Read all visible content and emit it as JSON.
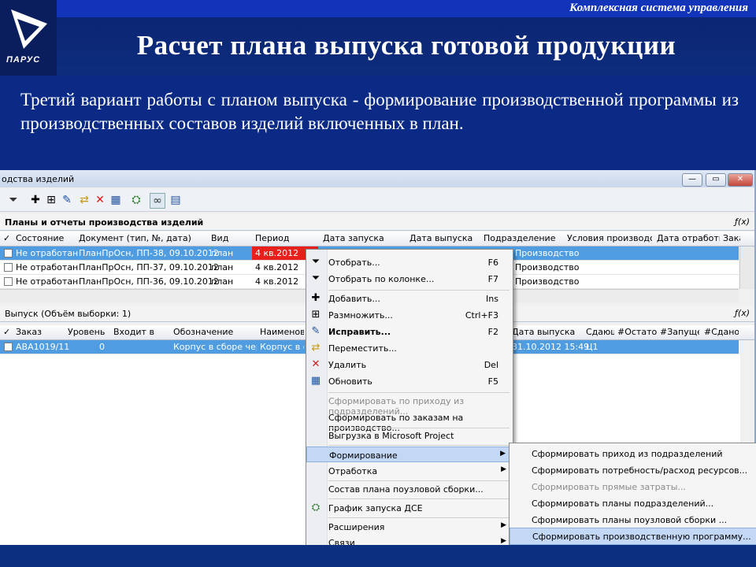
{
  "slide": {
    "header_strip": "Комплексная система управления",
    "logo_text": "ПАРУС",
    "title": "Расчет плана выпуска готовой продукции",
    "lead": "Третий  вариант работы с планом выпуска  - формирование производственной программы из производственных составов изделий включенных в план."
  },
  "window": {
    "title": "одства изделий",
    "controls": {
      "minimize": "—",
      "maximize": "▭",
      "close": "✕"
    }
  },
  "toolbar": {
    "icons": [
      "filter-icon",
      "add-icon",
      "multiply-icon",
      "edit-icon",
      "move-icon",
      "delete-icon",
      "refresh-icon",
      "network-icon",
      "binoculars-icon",
      "report-icon"
    ]
  },
  "plans": {
    "section_title": "Планы и отчеты производства изделий",
    "fx": "ƒ(x)",
    "columns": [
      "Состояние",
      "Документ (тип, №, дата)",
      "Вид",
      "Период",
      "Дата запуска",
      "Дата выпуска",
      "Подразделение",
      "Условия производства",
      "Дата отработки",
      "Зака"
    ],
    "rows": [
      {
        "state": "Не отработан",
        "doc": "ПланПрОсн, ПП-38, 09.10.2012",
        "kind": "план",
        "period": "4 кв.2012",
        "dept": "Производство"
      },
      {
        "state": "Не отработан",
        "doc": "ПланПрОсн, ПП-37, 09.10.2012",
        "kind": "план",
        "period": "4 кв.2012",
        "dept": "Производство"
      },
      {
        "state": "Не отработан",
        "doc": "ПланПрОсн, ПП-36, 09.10.2012",
        "kind": "план",
        "period": "4 кв.2012",
        "dept": "Производство"
      }
    ]
  },
  "output": {
    "section_title": "Выпуск (Объём выборки: 1)",
    "fx": "ƒ(x)",
    "columns": [
      "Заказ",
      "Уровень",
      "Входит в",
      "Обозначение",
      "Наименова",
      "Дата выпуска",
      "Сдающ",
      "#Остаток",
      "#Запущено",
      "#Сдано"
    ],
    "rows": [
      {
        "order": "ABA1019/11",
        "level": "0",
        "enters": "",
        "designation": "Корпус в сборе чертеж",
        "name": "Корпус в сбо",
        "date": "31.10.2012 15:49",
        "issuer": "Ц1"
      }
    ]
  },
  "context_menu": {
    "items": [
      {
        "label": "Отобрать...",
        "shortcut": "F6",
        "icon": "filter-icon"
      },
      {
        "label": "Отобрать по колонке...",
        "shortcut": "F7",
        "icon": "column-filter-icon"
      },
      {
        "label": "Добавить...",
        "shortcut": "Ins",
        "icon": "add-icon"
      },
      {
        "label": "Размножить...",
        "shortcut": "Ctrl+F3",
        "icon": "multiply-icon"
      },
      {
        "label": "Исправить...",
        "shortcut": "F2",
        "icon": "edit-icon"
      },
      {
        "label": "Переместить...",
        "shortcut": "",
        "icon": "move-icon"
      },
      {
        "label": "Удалить",
        "shortcut": "Del",
        "icon": "delete-icon"
      },
      {
        "label": "Обновить",
        "shortcut": "F5",
        "icon": "refresh-icon"
      },
      {
        "label": "Сформировать по приходу из подразделений...",
        "shortcut": "",
        "icon": ""
      },
      {
        "label": "Сформировать по заказам на производство...",
        "shortcut": "",
        "icon": ""
      },
      {
        "label": "Выгрузка в Microsoft Project",
        "shortcut": "",
        "icon": ""
      },
      {
        "label": "Формирование",
        "shortcut": "",
        "icon": ""
      },
      {
        "label": "Отработка",
        "shortcut": "",
        "icon": ""
      },
      {
        "label": "Состав плана поузловой сборки...",
        "shortcut": "",
        "icon": ""
      },
      {
        "label": "График запуска ДСЕ",
        "shortcut": "",
        "icon": "network-icon"
      },
      {
        "label": "Расширения",
        "shortcut": "",
        "icon": ""
      },
      {
        "label": "Связи",
        "shortcut": "",
        "icon": ""
      }
    ]
  },
  "submenu": {
    "items": [
      "Сформировать приход из подразделений",
      "Сформировать потребность/расход ресурсов...",
      "Сформировать прямые затраты...",
      "Сформировать планы подразделений...",
      "Сформировать планы поузловой сборки ...",
      "Сформировать производственную программу..."
    ]
  }
}
